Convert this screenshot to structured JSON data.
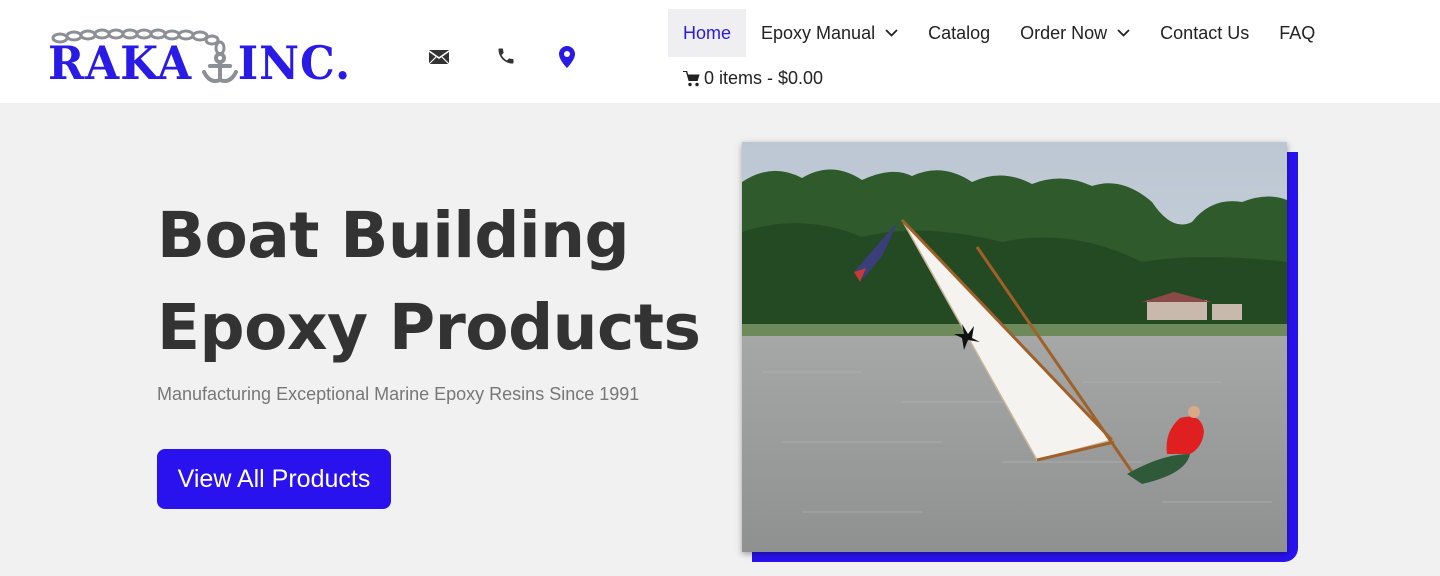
{
  "brand": {
    "name_left": "RAKA",
    "name_right": "INC.",
    "color": "#2a1ae6"
  },
  "contact_icons": [
    "envelope-icon",
    "phone-icon",
    "map-pin-icon"
  ],
  "nav": {
    "items": [
      {
        "label": "Home",
        "active": true,
        "dropdown": false
      },
      {
        "label": "Epoxy Manual",
        "active": false,
        "dropdown": true
      },
      {
        "label": "Catalog",
        "active": false,
        "dropdown": false
      },
      {
        "label": "Order Now",
        "active": false,
        "dropdown": true
      },
      {
        "label": "Contact Us",
        "active": false,
        "dropdown": false
      },
      {
        "label": "FAQ",
        "active": false,
        "dropdown": false
      }
    ],
    "cart_label": "0 items - $0.00"
  },
  "hero": {
    "title_line1": "Boat Building",
    "title_line2": "Epoxy Products",
    "subtitle": "Manufacturing Exceptional Marine Epoxy Resins Since 1991",
    "cta_label": "View All Products",
    "accent_color": "#2a12ee"
  }
}
